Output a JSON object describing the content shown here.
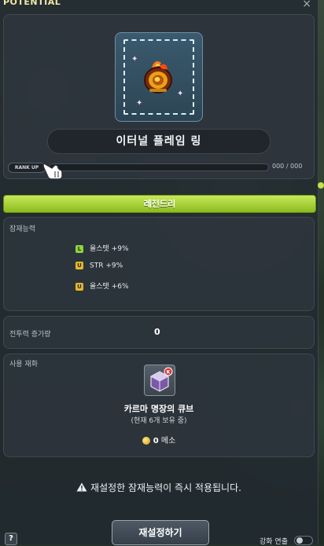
{
  "window": {
    "title": "POTENTIAL",
    "close_label": "×"
  },
  "item": {
    "name": "이터널 플레임 링",
    "icon": "flame-ring-icon"
  },
  "rank": {
    "label": "RANK UP",
    "value": "000 / 000",
    "progress": 0
  },
  "grade": {
    "label": "레전드리",
    "color": "#9ccc2a"
  },
  "potential": {
    "label": "잠재능력",
    "lines": [
      {
        "badge": "L",
        "text": "올스탯 +9%"
      },
      {
        "badge": "U",
        "text": "STR +9%"
      },
      {
        "badge": "U",
        "text": "올스탯 +6%"
      }
    ]
  },
  "combat": {
    "label": "전투력 증가량",
    "value": "0"
  },
  "material": {
    "label": "사용 재화",
    "cube_name": "카르마 명장의 큐브",
    "cube_count": "(현재 6개 보유 중)",
    "cube_icon": "karma-cube-icon",
    "meso_value": "0",
    "meso_unit": "메소"
  },
  "warning": {
    "text": "재설정한 잠재능력이 즉시 적용됩니다."
  },
  "buttons": {
    "reset": "재설정하기",
    "help": "?"
  },
  "bottom": {
    "toggle_label": "강화 연출"
  },
  "colors": {
    "accent": "#c8e04a",
    "legendary_badge": "#8fd43a",
    "unique_badge": "#e5b82a"
  }
}
